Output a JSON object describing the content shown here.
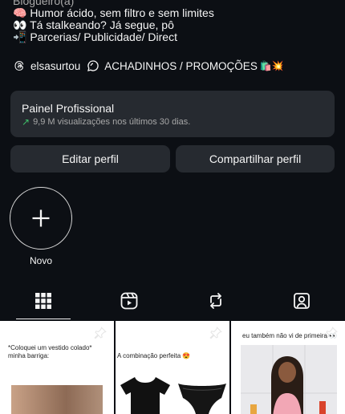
{
  "bio": {
    "category": "Blogueiro(a)",
    "lines": [
      "🧠 Humor ácido, sem filtro e sem limites",
      "👀 Tá stalkeando? Já segue, pô",
      "📲 Parcerias/ Publicidade/ Direct"
    ]
  },
  "links": {
    "threads_handle": "elsasurtou",
    "channel_name": "ACHADINHOS / PROMOÇÕES",
    "channel_emojis": "🛍️💥"
  },
  "panel": {
    "title": "Painel Profissional",
    "stat": "9,9 M visualizações nos últimos 30 dias."
  },
  "buttons": {
    "edit": "Editar perfil",
    "share": "Compartilhar perfil"
  },
  "highlight": {
    "label": "Novo"
  },
  "tabs": [
    {
      "name": "posts-grid",
      "icon": "grid-icon",
      "active": true
    },
    {
      "name": "reels",
      "icon": "reels-icon",
      "active": false
    },
    {
      "name": "reposts",
      "icon": "repost-icon",
      "active": false
    },
    {
      "name": "tagged",
      "icon": "tagged-icon",
      "active": false
    }
  ],
  "posts": [
    {
      "caption": "*Coloquei um vestido colado* minha barriga:"
    },
    {
      "caption": "A combinação perfeita 😍"
    },
    {
      "caption": "eu também não vi de primeira 👀"
    }
  ],
  "colors": {
    "background": "#0c0f14",
    "card": "#262a30",
    "text": "#f5f5f5",
    "muted": "#a8a8a8",
    "trend_up": "#3fbf6a"
  }
}
